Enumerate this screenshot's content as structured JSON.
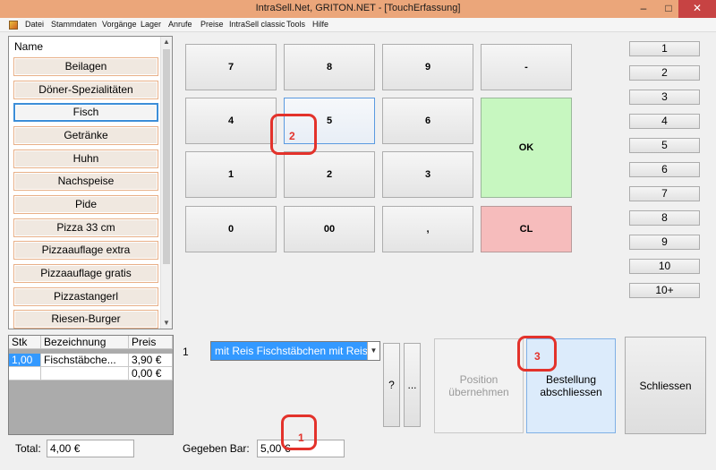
{
  "window": {
    "title": "IntraSell.Net, GRITON.NET - [TouchErfassung]",
    "minimize": "–",
    "maximize": "□",
    "close": "✕"
  },
  "menu": [
    "Datei",
    "Stammdaten",
    "Vorgänge",
    "Lager",
    "Anrufe",
    "Preise",
    "IntraSell classic",
    "Tools",
    "Hilfe"
  ],
  "groups": {
    "header": "Name",
    "items": [
      "Beilagen",
      "Döner-Spezialitäten",
      "Fisch",
      "Getränke",
      "Huhn",
      "Nachspeise",
      "Pide",
      "Pizza  33 cm",
      "Pizzaauflage extra",
      "Pizzaauflage gratis",
      "Pizzastangerl",
      "Riesen-Burger"
    ],
    "selected": "Fisch"
  },
  "keypad": {
    "k7": "7",
    "k8": "8",
    "k9": "9",
    "minus": "-",
    "k4": "4",
    "k5": "5",
    "k6": "6",
    "ok": "OK",
    "k1": "1",
    "k2": "2",
    "k3": "3",
    "k0": "0",
    "k00": "00",
    "comma": ",",
    "cl": "CL"
  },
  "quantity_buttons": [
    "1",
    "2",
    "3",
    "4",
    "5",
    "6",
    "7",
    "8",
    "9",
    "10",
    "10+"
  ],
  "order_table": {
    "headers": [
      "Stk",
      "Bezeichnung",
      "Preis"
    ],
    "rows": [
      {
        "stk": "1,00",
        "bez": "Fischstäbche...",
        "preis": "3,90 €"
      },
      {
        "stk": "",
        "bez": "",
        "preis": "0,00 €"
      }
    ]
  },
  "entry": {
    "qty_label": "1",
    "article": "mit Reis Fischstäbchen mit Reis",
    "question_btn": "?",
    "ellipsis_btn": "..."
  },
  "actions": {
    "position": "Position übernehmen",
    "bestellung": "Bestellung abschliessen",
    "schliessen": "Schliessen"
  },
  "totals": {
    "total_label": "Total:",
    "total_value": "4,00 €",
    "gegeben_label": "Gegeben Bar:",
    "gegeben_value": "5,00 €"
  },
  "annotations": [
    "1",
    "2",
    "3"
  ],
  "colors": {
    "titlebar": "#eba67a",
    "ok": "#c7f7c0",
    "cl": "#f6bcbc",
    "selection": "#3399ff",
    "annotation": "#e3322b"
  }
}
